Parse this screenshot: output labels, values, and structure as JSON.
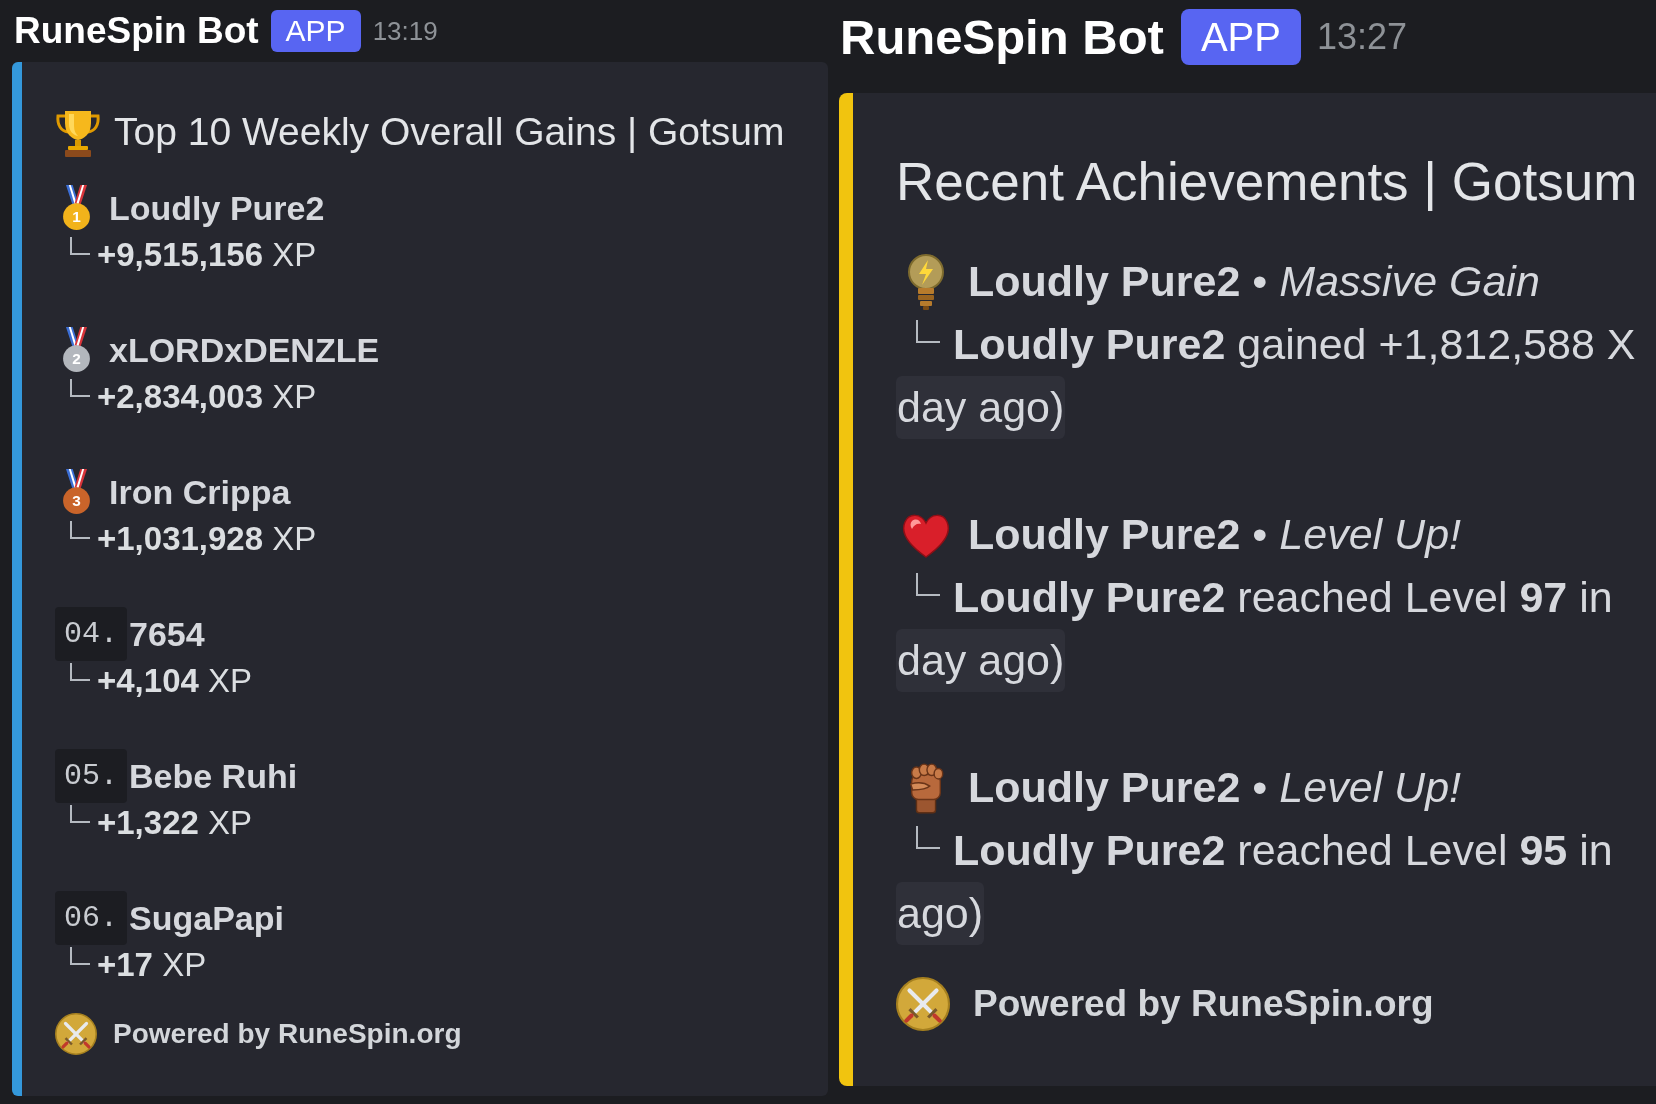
{
  "messages": [
    {
      "kind": "leaderboard",
      "author": "RuneSpin Bot",
      "badge": "APP",
      "time": "13:19",
      "embed": {
        "color": "#3498db",
        "title": "Top 10 Weekly Overall Gains | Gotsum",
        "entries": [
          {
            "kind": "medal",
            "color": "#f2b31b",
            "rank": "1",
            "name": "Loudly Pure2",
            "xp": "**+9,515,156** XP"
          },
          {
            "kind": "medal",
            "color": "#b3b7bd",
            "rank": "2",
            "name": "xLORDxDENZLE",
            "xp": "**+2,834,003** XP"
          },
          {
            "kind": "medal",
            "color": "#c9642a",
            "rank": "3",
            "name": "Iron Crippa",
            "xp": "**+1,031,928** XP"
          },
          {
            "kind": "numbered",
            "rank": "04.",
            "name": "7654",
            "xp": "**+4,104** XP"
          },
          {
            "kind": "numbered",
            "rank": "05.",
            "name": "Bebe Ruhi",
            "xp": "**+1,322** XP"
          },
          {
            "kind": "numbered",
            "rank": "06.",
            "name": "SugaPapi",
            "xp": "**+17** XP"
          }
        ],
        "footer": "Powered by RuneSpin.org"
      }
    },
    {
      "kind": "achievements",
      "author": "RuneSpin Bot",
      "badge": "APP",
      "time": "13:27",
      "embed": {
        "color": "#f1c40f",
        "title": "Recent Achievements | Gotsum",
        "entries": [
          {
            "kind": "bulb",
            "header": "**Loudly Pure2** • *Massive Gain*",
            "detail": "**Loudly Pure2** gained +1,812,588 X",
            "time_rest": "day ago)"
          },
          {
            "kind": "heart",
            "header": "**Loudly Pure2** • *Level Up!*",
            "detail": "**Loudly Pure2** reached Level **97** in",
            "time_rest": "day ago)"
          },
          {
            "kind": "fist",
            "header": "**Loudly Pure2** • *Level Up!*",
            "detail": "**Loudly Pure2** reached Level **95** in",
            "time_rest": "ago)"
          }
        ],
        "footer": "Powered by RuneSpin.org"
      }
    }
  ]
}
